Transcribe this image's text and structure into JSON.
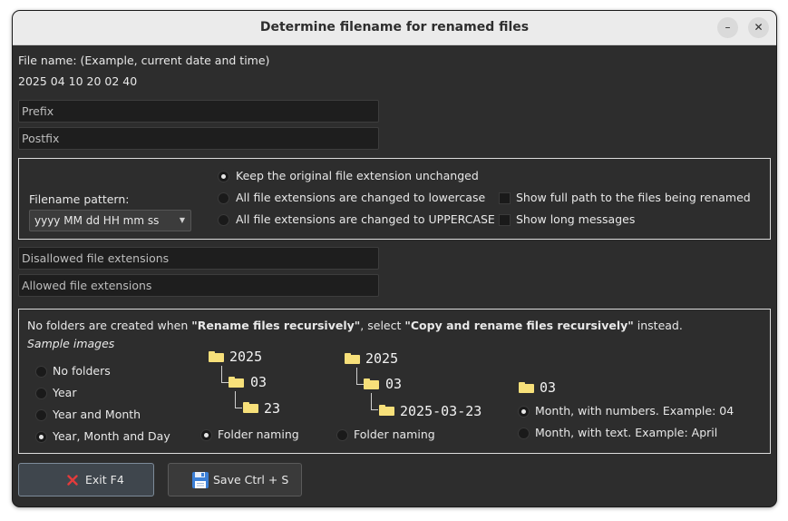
{
  "window": {
    "title": "Determine filename for renamed files",
    "minimize_glyph": "–",
    "close_glyph": "✕"
  },
  "file_name": {
    "label": "File name: (Example, current date and time)",
    "example": "2025 04 10 20 02 40"
  },
  "prefix": {
    "placeholder": "Prefix",
    "value": ""
  },
  "postfix": {
    "placeholder": "Postfix",
    "value": ""
  },
  "pattern_group": {
    "pattern_label": "Filename pattern:",
    "pattern_value": "yyyy MM dd HH mm ss",
    "extension_options": [
      {
        "label": "Keep the original file extension unchanged",
        "selected": true
      },
      {
        "label": "All file extensions are changed to lowercase",
        "selected": false
      },
      {
        "label": "All file extensions are changed to UPPERCASE",
        "selected": false
      }
    ],
    "checkboxes": [
      {
        "label": "Show full path to the files being renamed",
        "checked": false
      },
      {
        "label": "Show long messages",
        "checked": false
      }
    ]
  },
  "disallowed_extensions": {
    "placeholder": "Disallowed file extensions",
    "value": ""
  },
  "allowed_extensions": {
    "placeholder": "Allowed file extensions",
    "value": ""
  },
  "folders_group": {
    "note_prefix": "No folders are created when ",
    "note_bold_1": "\"Rename files recursively\"",
    "note_middle": ", select ",
    "note_bold_2": "\"Copy and rename files recursively\"",
    "note_suffix": " instead.",
    "sample_label": "Sample images",
    "folder_options": [
      {
        "label": "No folders",
        "selected": false
      },
      {
        "label": "Year",
        "selected": false
      },
      {
        "label": "Year and Month",
        "selected": false
      },
      {
        "label": "Year, Month and Day",
        "selected": true
      }
    ],
    "sample_1": {
      "year": "2025",
      "month": "03",
      "day": "23",
      "naming_label": "Folder naming",
      "selected": true
    },
    "sample_2": {
      "year": "2025",
      "month": "03",
      "day": "2025-03-23",
      "naming_label": "Folder naming",
      "selected": false
    },
    "sample_3": {
      "month": "03"
    },
    "month_options": [
      {
        "label": "Month, with numbers. Example: 04",
        "selected": true
      },
      {
        "label": "Month, with text. Example: April",
        "selected": false
      }
    ]
  },
  "buttons": {
    "exit_label": "Exit F4",
    "save_label": "Save Ctrl + S"
  },
  "colors": {
    "background": "#2d2d2d",
    "titlebar": "#ebebeb",
    "folder": "#f7e07a",
    "exit_icon": "#e33b3b",
    "save_icon": "#3b7fd6"
  },
  "icons": [
    "minimize-icon",
    "close-icon",
    "chevron-down-icon",
    "folder-icon",
    "cross-icon",
    "floppy-disk-icon"
  ]
}
